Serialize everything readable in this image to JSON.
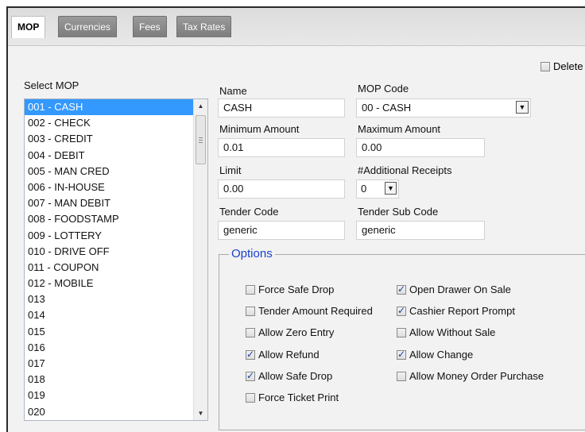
{
  "tabs": [
    {
      "label": "MOP",
      "active": true
    },
    {
      "label": "Currencies",
      "active": false
    },
    {
      "label": "Fees",
      "active": false
    },
    {
      "label": "Tax Rates",
      "active": false
    }
  ],
  "delete_label": "Delete",
  "select_mop_label": "Select MOP",
  "mop_list": [
    "001 - CASH",
    "002 - CHECK",
    "003 - CREDIT",
    "004 - DEBIT",
    "005 - MAN CRED",
    "006 - IN-HOUSE",
    "007 - MAN DEBIT",
    "008 - FOODSTAMP",
    "009 - LOTTERY",
    "010 - DRIVE OFF",
    "011 - COUPON",
    "012 - MOBILE",
    "013",
    "014",
    "015",
    "016",
    "017",
    "018",
    "019",
    "020"
  ],
  "form": {
    "name_label": "Name",
    "name_value": "CASH",
    "mop_code_label": "MOP Code",
    "mop_code_value": "00 - CASH",
    "min_label": "Minimum Amount",
    "min_value": "0.01",
    "max_label": "Maximum Amount",
    "max_value": "0.00",
    "limit_label": "Limit",
    "limit_value": "0.00",
    "receipts_label": "#Additional Receipts",
    "receipts_value": "0",
    "tender_code_label": "Tender Code",
    "tender_code_value": "generic",
    "tender_sub_label": "Tender Sub Code",
    "tender_sub_value": "generic"
  },
  "options": {
    "legend": "Options",
    "left": [
      {
        "label": "Force Safe Drop",
        "checked": false
      },
      {
        "label": "Tender Amount Required",
        "checked": false
      },
      {
        "label": "Allow Zero Entry",
        "checked": false
      },
      {
        "label": "Allow Refund",
        "checked": true
      },
      {
        "label": "Allow Safe Drop",
        "checked": true
      },
      {
        "label": "Force Ticket Print",
        "checked": false
      }
    ],
    "right": [
      {
        "label": "Open Drawer On Sale",
        "checked": true
      },
      {
        "label": "Cashier Report Prompt",
        "checked": true
      },
      {
        "label": "Allow Without Sale",
        "checked": false
      },
      {
        "label": "Allow Change",
        "checked": true
      },
      {
        "label": "Allow Money Order Purchase",
        "checked": false
      }
    ]
  },
  "colors": {
    "selection": "#3399ff",
    "legend": "#1a3fd0"
  }
}
